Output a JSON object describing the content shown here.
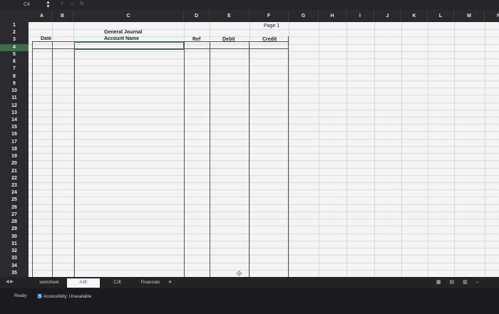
{
  "formula_bar": {
    "cell_ref": "C4",
    "stepper_icon": "up-down-arrows",
    "cancel_icon": "x",
    "confirm_icon": "check",
    "fx_label": "fx"
  },
  "columns": [
    "A",
    "B",
    "C",
    "D",
    "E",
    "F",
    "G",
    "H",
    "I",
    "J",
    "K",
    "L",
    "M",
    "N"
  ],
  "rows": [
    "1",
    "2",
    "3",
    "4",
    "5",
    "6",
    "7",
    "8",
    "9",
    "10",
    "11",
    "12",
    "13",
    "14",
    "15",
    "16",
    "17",
    "18",
    "19",
    "20",
    "21",
    "22",
    "23",
    "24",
    "25",
    "26",
    "27",
    "28",
    "29",
    "30",
    "31",
    "32",
    "33",
    "34",
    "35"
  ],
  "selected_row": "4",
  "cells": {
    "page": "Page 1",
    "title": "General Journal",
    "date": "Date",
    "account_name": "Account Name",
    "ref": "Ref",
    "debit": "Debit",
    "credit": "Credit"
  },
  "tabs": [
    {
      "label": "worksheet",
      "active": false
    },
    {
      "label": "AJE",
      "active": true
    },
    {
      "label": "CJE",
      "active": false
    },
    {
      "label": "Financials",
      "active": false
    }
  ],
  "tab_add_label": "+",
  "tab_nav_label": "◀ ▶",
  "status": {
    "ready": "Ready",
    "accessibility": "Accessibility: Unavailable"
  },
  "view_icons": "▦ ▤ ▥ –",
  "accent_color": "#2f7d4a"
}
